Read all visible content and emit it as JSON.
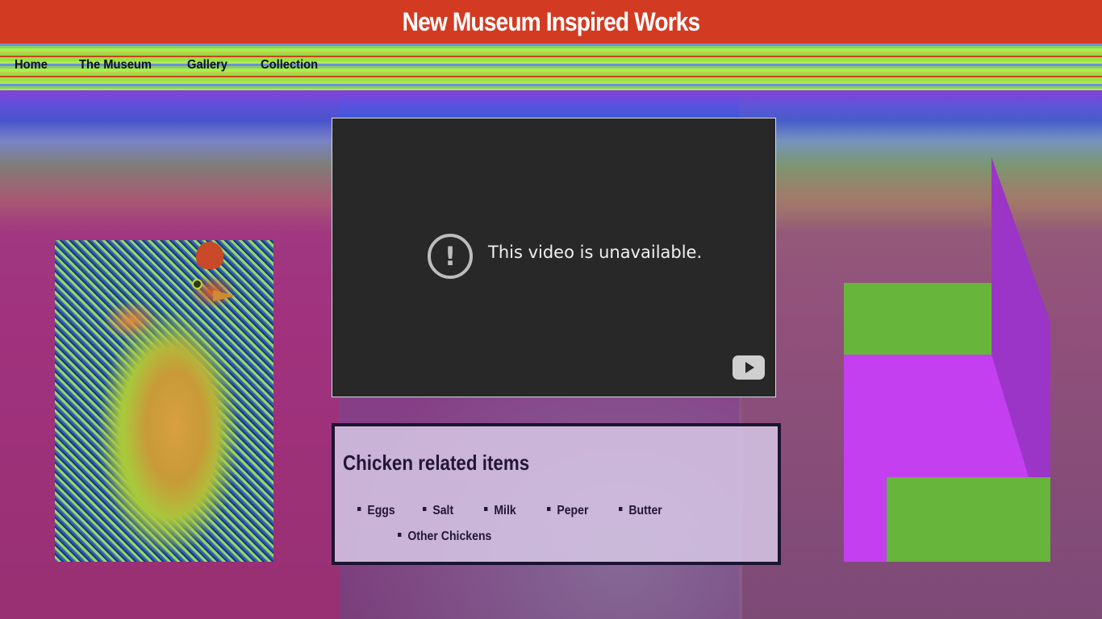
{
  "header": {
    "title": "New Museum Inspired Works"
  },
  "nav": {
    "items": [
      {
        "label": "Home"
      },
      {
        "label": "The Museum"
      },
      {
        "label": "Gallery"
      },
      {
        "label": "Collection"
      }
    ]
  },
  "video": {
    "message": "This video is unavailable.",
    "warning_glyph": "!",
    "icon": "exclamation-circle-icon",
    "play_icon": "youtube-play-icon"
  },
  "items_panel": {
    "heading": "Chicken related items",
    "items": [
      "Eggs",
      "Salt",
      "Milk",
      "Peper",
      "Butter",
      "Other Chickens"
    ]
  },
  "colors": {
    "title_bar": "#d33a22",
    "title_text": "#ffffff",
    "panel_text": "#231637",
    "shape_green": "#67b53a",
    "shape_magenta": "#c33ff0",
    "shape_purple": "#9a35c8"
  }
}
